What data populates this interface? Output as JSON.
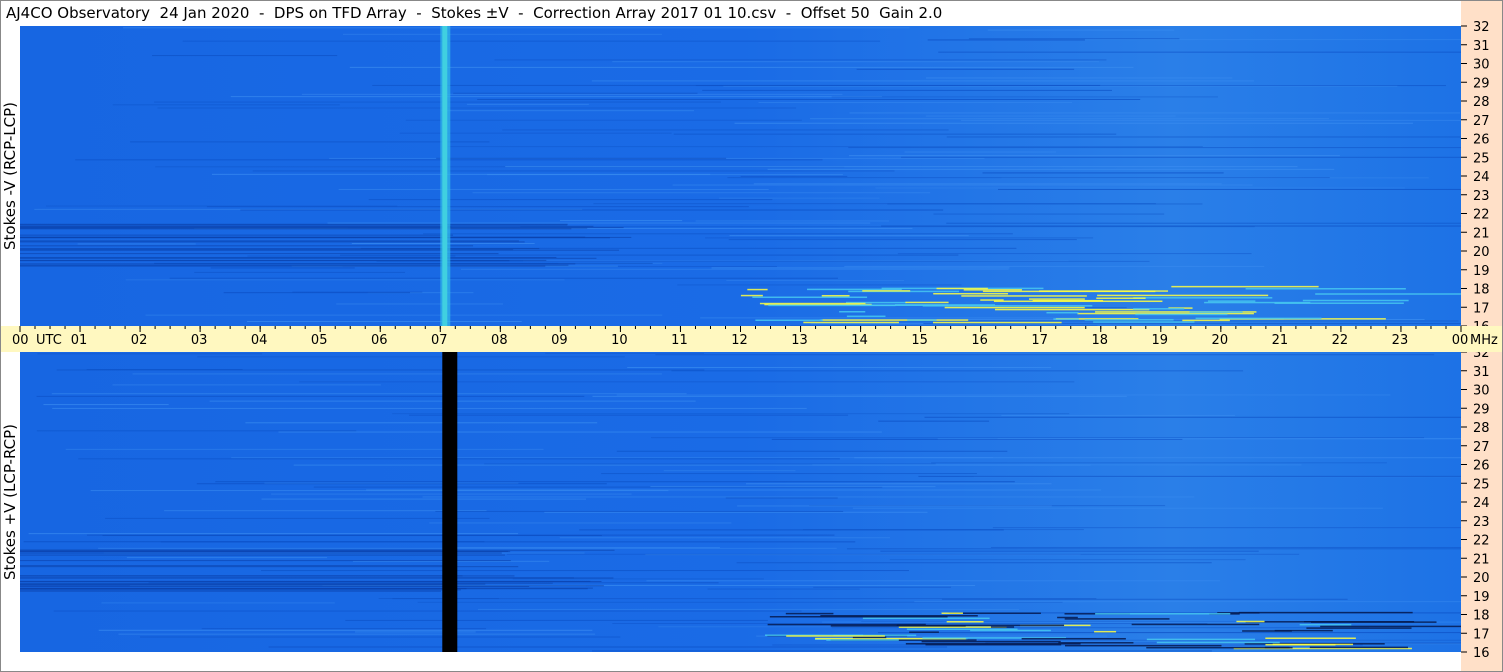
{
  "title": "AJ4CO Observatory  24 Jan 2020  -  DPS on TFD Array  -  Stokes ±V  -  Correction Array 2017 01 10.csv  -  Offset 50  Gain 2.0",
  "colors": {
    "background_blue": "#1a6ee6",
    "time_axis_bg": "#fff8c0",
    "freq_axis_bg": "#ffe0c8",
    "burst_highlight": "#ffff40",
    "cyan_band": "#40d0e0",
    "dark_band": "#000000"
  },
  "chart_data": [
    {
      "type": "heatmap",
      "name": "Stokes -V panel",
      "ylabel": "Stokes -V (RCP-LCP)",
      "x_unit": "UTC",
      "x_range": [
        0,
        24
      ],
      "x_ticks": [
        "00",
        "UTC",
        "01",
        "02",
        "03",
        "04",
        "05",
        "06",
        "07",
        "08",
        "09",
        "10",
        "11",
        "12",
        "13",
        "14",
        "15",
        "16",
        "17",
        "18",
        "19",
        "20",
        "21",
        "22",
        "23",
        "00",
        "MHz"
      ],
      "y_unit": "MHz",
      "y_range": [
        16,
        32
      ],
      "y_ticks": [
        "32",
        "31",
        "30",
        "29",
        "28",
        "27",
        "26",
        "25",
        "24",
        "23",
        "22",
        "21",
        "20",
        "19",
        "18",
        "17",
        "16"
      ],
      "vertical_band": {
        "hour": 7.05,
        "color": "cyan"
      }
    },
    {
      "type": "heatmap",
      "name": "Stokes +V panel",
      "ylabel": "Stokes +V (LCP-RCP)",
      "x_unit": "UTC",
      "x_range": [
        0,
        24
      ],
      "y_unit": "MHz",
      "y_range": [
        16,
        32
      ],
      "y_ticks": [
        "32",
        "31",
        "30",
        "29",
        "28",
        "27",
        "26",
        "25",
        "24",
        "23",
        "22",
        "21",
        "20",
        "19",
        "18",
        "17",
        "16"
      ],
      "vertical_band": {
        "hour": 7.05,
        "color": "black"
      }
    }
  ]
}
